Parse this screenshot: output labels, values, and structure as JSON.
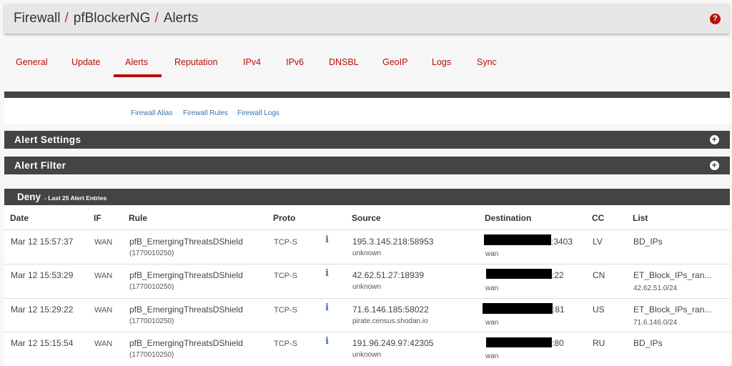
{
  "breadcrumb": {
    "items": [
      "Firewall",
      "pfBlockerNG",
      "Alerts"
    ],
    "separator": "/"
  },
  "help_icon": {
    "glyph": "?"
  },
  "tabs": [
    "General",
    "Update",
    "Alerts",
    "Reputation",
    "IPv4",
    "IPv6",
    "DNSBL",
    "GeoIP",
    "Logs",
    "Sync"
  ],
  "active_tab": "Alerts",
  "links": [
    "Firewall Alias",
    "Firewall Rules",
    "Firewall Logs"
  ],
  "sections": {
    "alert_settings": "Alert Settings",
    "alert_filter": "Alert Filter"
  },
  "deny": {
    "title": "Deny",
    "subtitle": "- Last 25 Alert Entries"
  },
  "table": {
    "headers": [
      "Date",
      "IF",
      "Rule",
      "Proto",
      "Source",
      "Destination",
      "CC",
      "List"
    ],
    "rows": [
      {
        "date": "Mar 12 15:57:37",
        "if": "WAN",
        "rule": "pfB_EmergingThreatsDShield",
        "rule_id": "(1770010250)",
        "proto": "TCP-S",
        "source": "195.3.145.218:58953",
        "source_host": "unknown",
        "dest_suffix": ":3403",
        "dest_if": "wan",
        "cc": "LV",
        "list": "BD_IPs",
        "list_sub": ""
      },
      {
        "date": "Mar 12 15:53:29",
        "if": "WAN",
        "rule": "pfB_EmergingThreatsDShield",
        "rule_id": "(1770010250)",
        "proto": "TCP-S",
        "source": "42.62.51.27:18939",
        "source_host": "unknown",
        "dest_suffix": ":22",
        "dest_if": "wan",
        "cc": "CN",
        "list": "ET_Block_IPs_ran...",
        "list_sub": "42.62.51.0/24"
      },
      {
        "date": "Mar 12 15:29:22",
        "if": "WAN",
        "rule": "pfB_EmergingThreatsDShield",
        "rule_id": "(1770010250)",
        "proto": "TCP-S",
        "source": "71.6.146.185:58022",
        "source_host": "pirate.census.shodan.io",
        "dest_suffix": ":81",
        "dest_if": "wan",
        "cc": "US",
        "list": "ET_Block_IPs_ran...",
        "list_sub": "71.6.146.0/24"
      },
      {
        "date": "Mar 12 15:15:54",
        "if": "WAN",
        "rule": "pfB_EmergingThreatsDShield",
        "rule_id": "(1770010250)",
        "proto": "TCP-S",
        "source": "191.96.249.97:42305",
        "source_host": "unknown",
        "dest_suffix": ":80",
        "dest_if": "wan",
        "cc": "RU",
        "list": "BD_IPs",
        "list_sub": ""
      }
    ]
  },
  "colors": {
    "accent": "#b80f0a",
    "panel": "#444444",
    "link": "#3b73ad"
  }
}
